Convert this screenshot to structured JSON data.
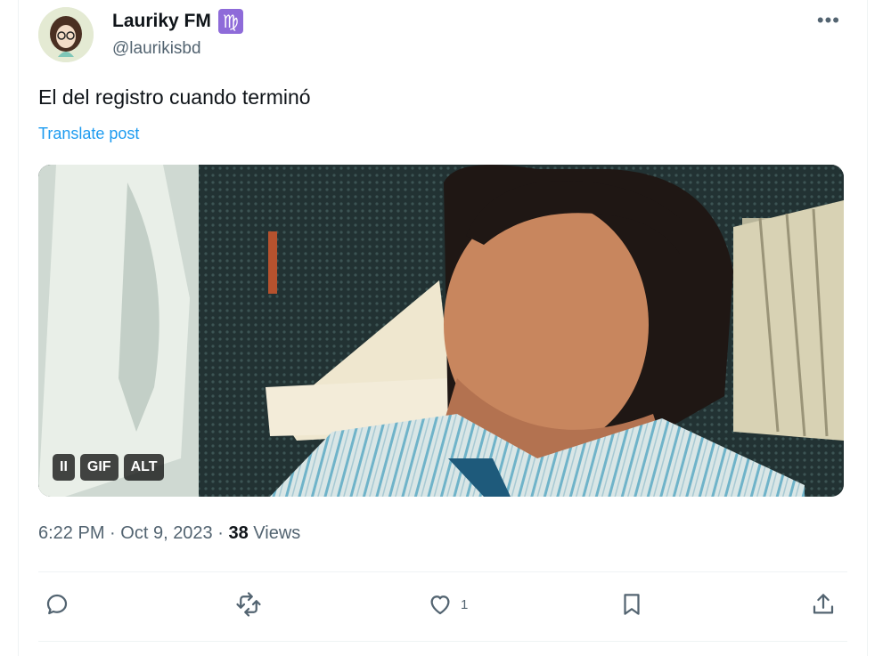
{
  "post": {
    "author": {
      "display_name": "Lauriky FM",
      "badge_glyph": "♍",
      "handle": "@laurikisbd"
    },
    "more_glyph": "•••",
    "text": "El del registro cuando terminó",
    "translate_label": "Translate post",
    "media": {
      "pause_glyph": "II",
      "gif_label": "GIF",
      "alt_label": "ALT"
    },
    "meta": {
      "time": "6:22 PM",
      "sep1": "·",
      "date": "Oct 9, 2023",
      "sep2": "·",
      "views_count": "38",
      "views_label": "Views"
    },
    "actions": {
      "reply_icon": "reply-icon",
      "repost_icon": "repost-icon",
      "like_icon": "heart-icon",
      "like_count": "1",
      "bookmark_icon": "bookmark-icon",
      "share_icon": "share-icon"
    }
  },
  "colors": {
    "text_primary": "#0f1419",
    "text_secondary": "#536471",
    "link": "#1d9bf0",
    "badge_bg": "#8e6bd9",
    "divider": "#eff3f4"
  }
}
